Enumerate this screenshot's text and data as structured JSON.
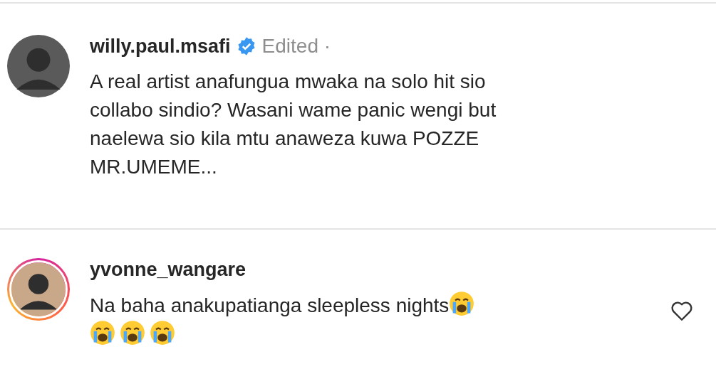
{
  "comments": [
    {
      "username": "willy.paul.msafi",
      "verified": true,
      "has_story": false,
      "meta": "Edited ·",
      "text": "A real artist anafungua mwaka na solo hit sio collabo sindio? Wasani wame panic wengi but naelewa  sio kila mtu anaweza kuwa POZZE MR.UMEME...",
      "show_like": false
    },
    {
      "username": "yvonne_wangare",
      "verified": false,
      "has_story": true,
      "text": "Na baha anakupatianga sleepless nights",
      "emoji": [
        {
          "kind": "crying"
        },
        {
          "kind": "crying"
        },
        {
          "kind": "crying"
        },
        {
          "kind": "crying"
        }
      ],
      "show_like": true
    }
  ]
}
